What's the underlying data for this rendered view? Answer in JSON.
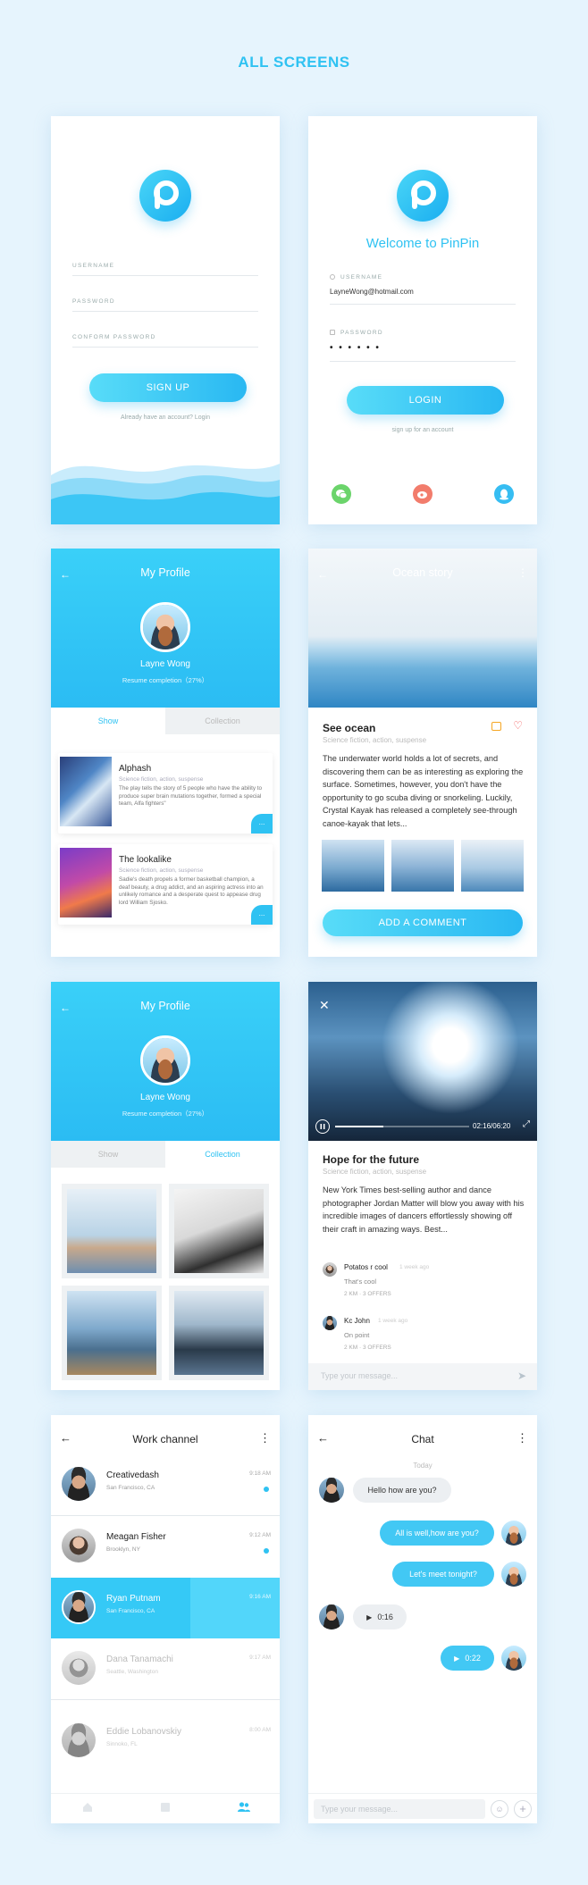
{
  "page_title": "ALL SCREENS",
  "signup": {
    "username_label": "USERNAME",
    "password_label": "PASSWORD",
    "confirm_label": "CONFORM PASSWORD",
    "button": "SIGN UP",
    "footer": "Already have an account? Login"
  },
  "login": {
    "welcome": "Welcome to PinPin",
    "username_label": "USERNAME",
    "username_value": "LayneWong@hotmail.com",
    "password_label": "PASSWORD",
    "password_value": "• • • • • •",
    "button": "LOGIN",
    "footer": "sign up for an account",
    "social": [
      "wechat-icon",
      "weibo-icon",
      "qq-icon"
    ]
  },
  "profile": {
    "header": "My Profile",
    "name": "Layne Wong",
    "completion": "Resume completion（27%）",
    "tabs": [
      "Show",
      "Collection"
    ],
    "cards": [
      {
        "title": "Alphash",
        "tags": "Science fiction, action, suspense",
        "desc": "The play tells the story of 5 people who have the ability to produce super brain mutations together, formed a special team, Alfa fighters\"",
        "more": "..."
      },
      {
        "title": "The lookalike",
        "tags": "Science fiction, action, suspense",
        "desc": "Sadie's death propels a former basketball champion, a deaf beauty, a drug addict, and an aspiring actress into an unlikely romance and a desperate quest to appease drug lord William Sjosko.",
        "more": "..."
      }
    ]
  },
  "story": {
    "header": "Ocean story",
    "title": "See ocean",
    "tags": "Science fiction, action, suspense",
    "body": "The underwater world holds a lot of secrets, and discovering them can be as interesting as exploring the surface. Sometimes, however, you don't have the opportunity to go scuba diving or snorkeling. Luckily, Crystal Kayak has released a completely see-through canoe-kayak that lets...",
    "button": "ADD A COMMENT"
  },
  "video": {
    "time": "02:16/06:20",
    "title": "Hope for the future",
    "tags": "Science fiction, action, suspense",
    "body": "New York Times best-selling author and dance photographer Jordan Matter will blow you away with his incredible images of dancers effortlessly showing off their craft in amazing ways. Best...",
    "comments": [
      {
        "name": "Potatos r cool",
        "time": "1 week ago",
        "text": "That's cool",
        "meta": "2 KM · 3 OFFERS"
      },
      {
        "name": "Kc John",
        "time": "1 week ago",
        "text": "On point",
        "meta": "2 KM · 3 OFFERS"
      }
    ],
    "input_placeholder": "Type your message..."
  },
  "work": {
    "header": "Work channel",
    "rows": [
      {
        "name": "Creativedash",
        "loc": "San Francisco, CA",
        "time": "9:18 AM"
      },
      {
        "name": "Meagan Fisher",
        "loc": "Brooklyn, NY",
        "time": "9:12 AM"
      },
      {
        "name": "Ryan Putnam",
        "loc": "San Francisco, CA",
        "time": "9:16 AM"
      },
      {
        "name": "Dana Tanamachi",
        "loc": "Seattle, Washington",
        "time": "9:17 AM"
      },
      {
        "name": "Eddie Lobanovskiy",
        "loc": "Sinnoko, FL",
        "time": "8:00 AM"
      }
    ]
  },
  "chat": {
    "header": "Chat",
    "day": "Today",
    "msg1": "Hello how are you?",
    "msg2": "All is well,how are you?",
    "msg3": "Let's meet tonight?",
    "voice1": "0:16",
    "voice2": "0:22",
    "input_placeholder": "Type your message..."
  },
  "colors": {
    "accent": "#2fc2f2",
    "background": "#e6f4fd"
  }
}
